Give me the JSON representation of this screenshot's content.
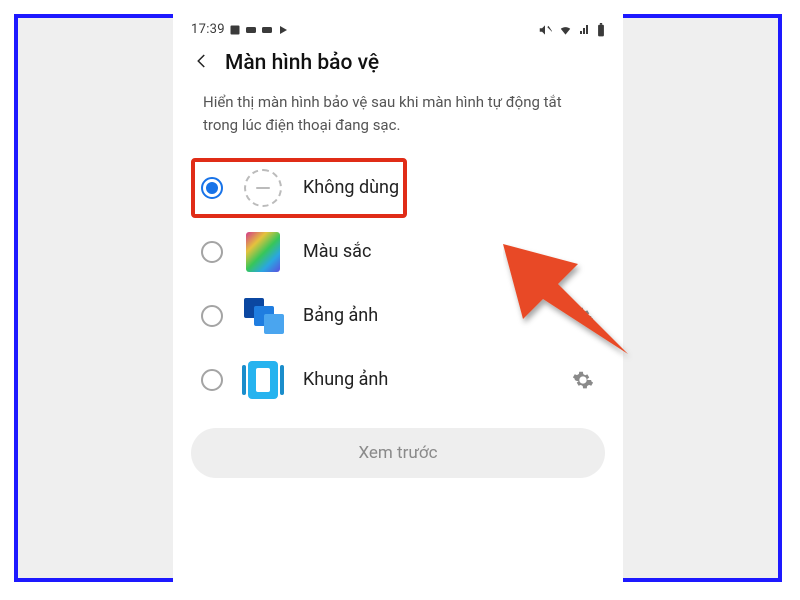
{
  "statusbar": {
    "time": "17:39"
  },
  "header": {
    "title": "Màn hình bảo vệ"
  },
  "description": "Hiển thị màn hình bảo vệ sau khi màn hình tự động tắt trong lúc điện thoại đang sạc.",
  "options": [
    {
      "label": "Không dùng",
      "selected": true,
      "has_gear": false,
      "highlight": true
    },
    {
      "label": "Màu sắc",
      "selected": false,
      "has_gear": false,
      "highlight": false
    },
    {
      "label": "Bảng ảnh",
      "selected": false,
      "has_gear": true,
      "highlight": false
    },
    {
      "label": "Khung ảnh",
      "selected": false,
      "has_gear": true,
      "highlight": false
    }
  ],
  "preview_button": "Xem trước",
  "colors": {
    "accent": "#1873e8",
    "highlight": "#e02c17",
    "frame": "#1d19ff"
  }
}
